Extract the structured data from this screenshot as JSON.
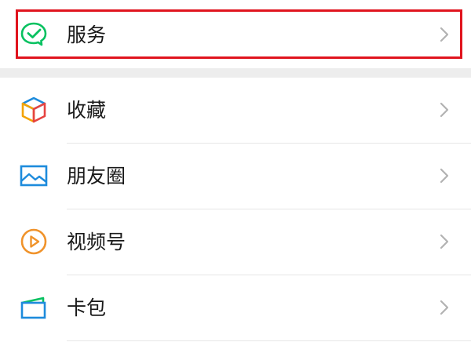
{
  "menu": {
    "items": [
      {
        "label": "服务",
        "icon": "wechat-pay-check-icon",
        "color": "#07c160"
      },
      {
        "label": "收藏",
        "icon": "favorites-cube-icon",
        "color": "#f4a300"
      },
      {
        "label": "朋友圈",
        "icon": "moments-picture-icon",
        "color": "#1d8bdc"
      },
      {
        "label": "视频号",
        "icon": "channels-play-icon",
        "color": "#f0932b"
      },
      {
        "label": "卡包",
        "icon": "card-wallet-icon",
        "color": "#1d8bdc"
      }
    ]
  },
  "highlight": {
    "target": "服务",
    "color": "#e0141e"
  }
}
